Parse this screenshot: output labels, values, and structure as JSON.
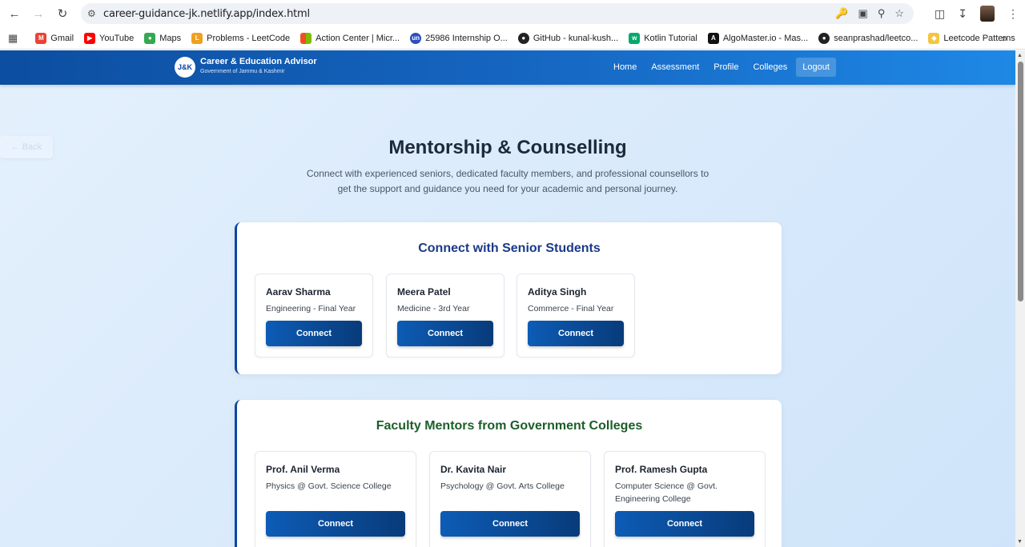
{
  "browser": {
    "url": "career-guidance-jk.netlify.app/index.html",
    "bookmarks": [
      {
        "label": "Gmail",
        "icon": "gmail-icon",
        "color": "#ea4335"
      },
      {
        "label": "YouTube",
        "icon": "youtube-icon",
        "color": "#ff0000"
      },
      {
        "label": "Maps",
        "icon": "maps-icon",
        "color": "#34a853"
      },
      {
        "label": "Problems - LeetCode",
        "icon": "leetcode-icon",
        "color": "#f0a020"
      },
      {
        "label": "Action Center | Micr...",
        "icon": "microsoft-icon",
        "color": "#f25022"
      },
      {
        "label": "25986 Internship O...",
        "icon": "unstop-icon",
        "color": "#2a4fbf"
      },
      {
        "label": "GitHub - kunal-kush...",
        "icon": "github-icon",
        "color": "#222222"
      },
      {
        "label": "Kotlin Tutorial",
        "icon": "w3schools-icon",
        "color": "#04aa6d"
      },
      {
        "label": "AlgoMaster.io - Mas...",
        "icon": "algomaster-icon",
        "color": "#111111"
      },
      {
        "label": "seanprashad/leetco...",
        "icon": "github-icon",
        "color": "#222222"
      },
      {
        "label": "Leetcode Patterns",
        "icon": "leetcode-patterns-icon",
        "color": "#f5c542"
      }
    ]
  },
  "header": {
    "logo_text": "J&K",
    "title": "Career & Education Advisor",
    "subtitle": "Government of Jammu & Kashmir",
    "nav": [
      "Home",
      "Assessment",
      "Profile",
      "Colleges",
      "Logout"
    ]
  },
  "back_label": "← Back",
  "page": {
    "title": "Mentorship & Counselling",
    "description": "Connect with experienced seniors, dedicated faculty members, and professional counsellors to get the support and guidance you need for your academic and personal journey."
  },
  "sections": [
    {
      "title": "Connect with Senior Students",
      "title_color": "#1a3a8a",
      "mentors": [
        {
          "name": "Aarav Sharma",
          "detail": "Engineering - Final Year",
          "button": "Connect"
        },
        {
          "name": "Meera Patel",
          "detail": "Medicine - 3rd Year",
          "button": "Connect"
        },
        {
          "name": "Aditya Singh",
          "detail": "Commerce - Final Year",
          "button": "Connect"
        }
      ]
    },
    {
      "title": "Faculty Mentors from Government Colleges",
      "title_color": "#1b5e2a",
      "mentors": [
        {
          "name": "Prof. Anil Verma",
          "detail": "Physics @ Govt. Science College",
          "button": "Connect"
        },
        {
          "name": "Dr. Kavita Nair",
          "detail": "Psychology @ Govt. Arts College",
          "button": "Connect"
        },
        {
          "name": "Prof. Ramesh Gupta",
          "detail": "Computer Science @ Govt. Engineering College",
          "button": "Connect"
        }
      ]
    }
  ]
}
